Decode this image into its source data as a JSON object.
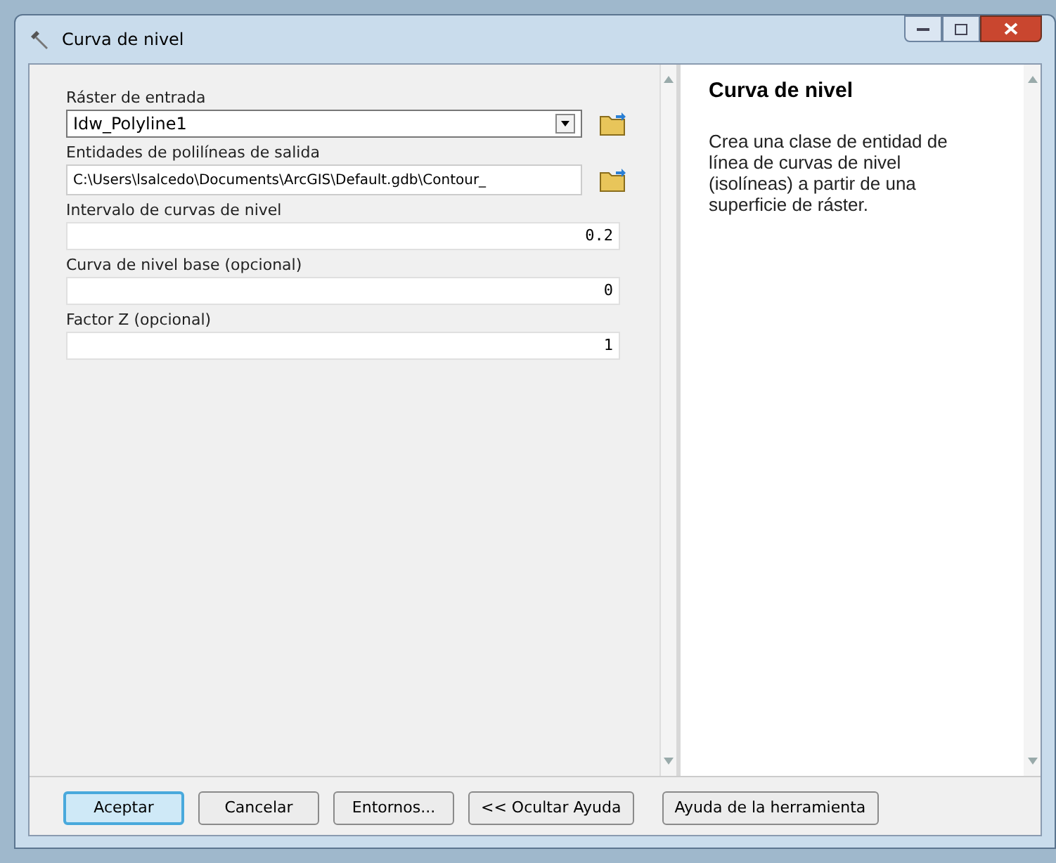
{
  "window": {
    "title": "Curva de nivel"
  },
  "params": [
    {
      "label": "Ráster de entrada",
      "kind": "combo",
      "value": "Idw_Polyline1",
      "browse": true
    },
    {
      "label": "Entidades de polilíneas de salida",
      "kind": "path",
      "value": "C:\\Users\\lsalcedo\\Documents\\ArcGIS\\Default.gdb\\Contour_",
      "browse": true
    },
    {
      "label": "Intervalo de curvas de nivel",
      "kind": "number",
      "value": "0.2",
      "browse": false
    },
    {
      "label": "Curva de nivel base (opcional)",
      "kind": "number",
      "value": "0",
      "browse": false
    },
    {
      "label": "Factor Z (opcional)",
      "kind": "number",
      "value": "1",
      "browse": false
    }
  ],
  "help": {
    "title": "Curva de nivel",
    "text": "Crea una clase de entidad de línea de curvas de nivel (isolíneas) a partir de una superficie de ráster."
  },
  "buttons": [
    {
      "label": "Aceptar",
      "selected": true
    },
    {
      "label": "Cancelar",
      "selected": false
    },
    {
      "label": "Entornos...",
      "selected": false
    },
    {
      "label": "<< Ocultar Ayuda",
      "selected": false
    },
    {
      "label": "Ayuda de la herramienta",
      "selected": false
    }
  ]
}
